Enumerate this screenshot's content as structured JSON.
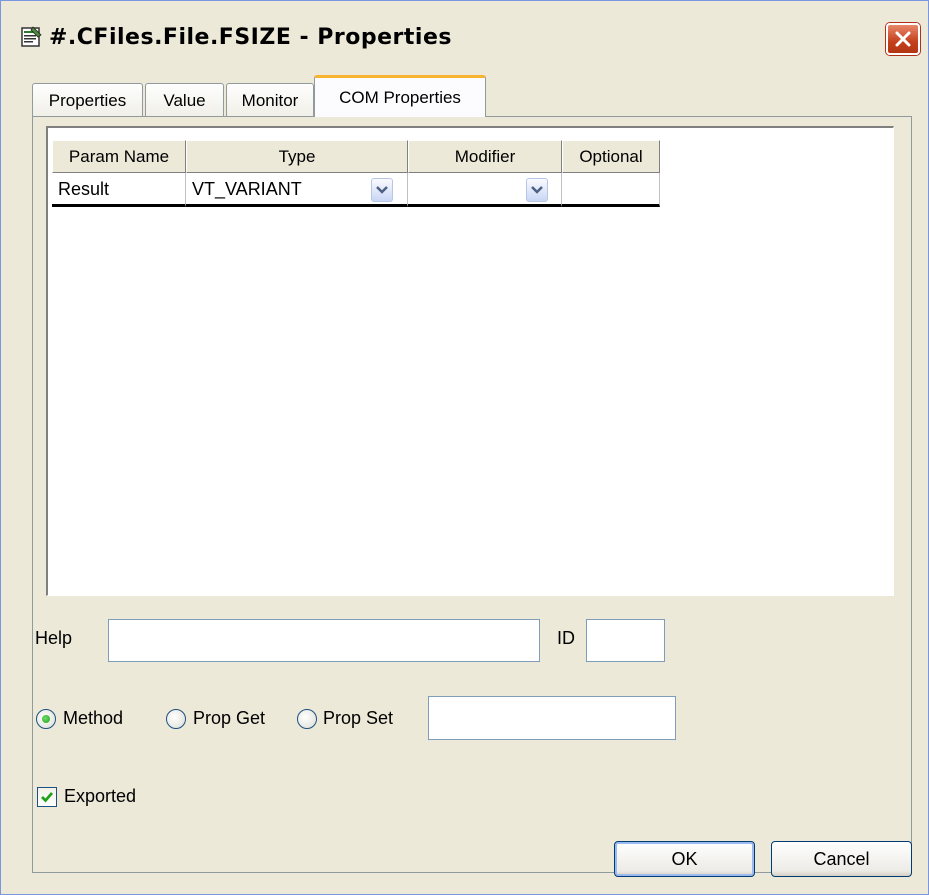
{
  "window": {
    "title": "#.CFiles.File.FSIZE - Properties",
    "icon": "properties-icon"
  },
  "tabs": [
    {
      "label": "Properties",
      "active": false
    },
    {
      "label": "Value",
      "active": false
    },
    {
      "label": "Monitor",
      "active": false
    },
    {
      "label": "COM Properties",
      "active": true
    }
  ],
  "params_table": {
    "columns": [
      "Param Name",
      "Type",
      "Modifier",
      "Optional"
    ],
    "rows": [
      {
        "param_name": "Result",
        "type": "VT_VARIANT",
        "modifier": "",
        "optional": ""
      }
    ]
  },
  "help": {
    "label": "Help",
    "value": ""
  },
  "id_field": {
    "label": "ID",
    "value": ""
  },
  "kind": {
    "options": [
      {
        "label": "Method",
        "selected": true
      },
      {
        "label": "Prop Get",
        "selected": false
      },
      {
        "label": "Prop Set",
        "selected": false
      }
    ],
    "extra_value": ""
  },
  "exported": {
    "label": "Exported",
    "checked": true
  },
  "buttons": {
    "ok": "OK",
    "cancel": "Cancel"
  },
  "colors": {
    "window_bg": "#ece9d8",
    "active_tab_accent": "#f8b331",
    "close_button": "#c4401c",
    "radio_dot": "#21a11a",
    "check_mark": "#21a11a"
  }
}
